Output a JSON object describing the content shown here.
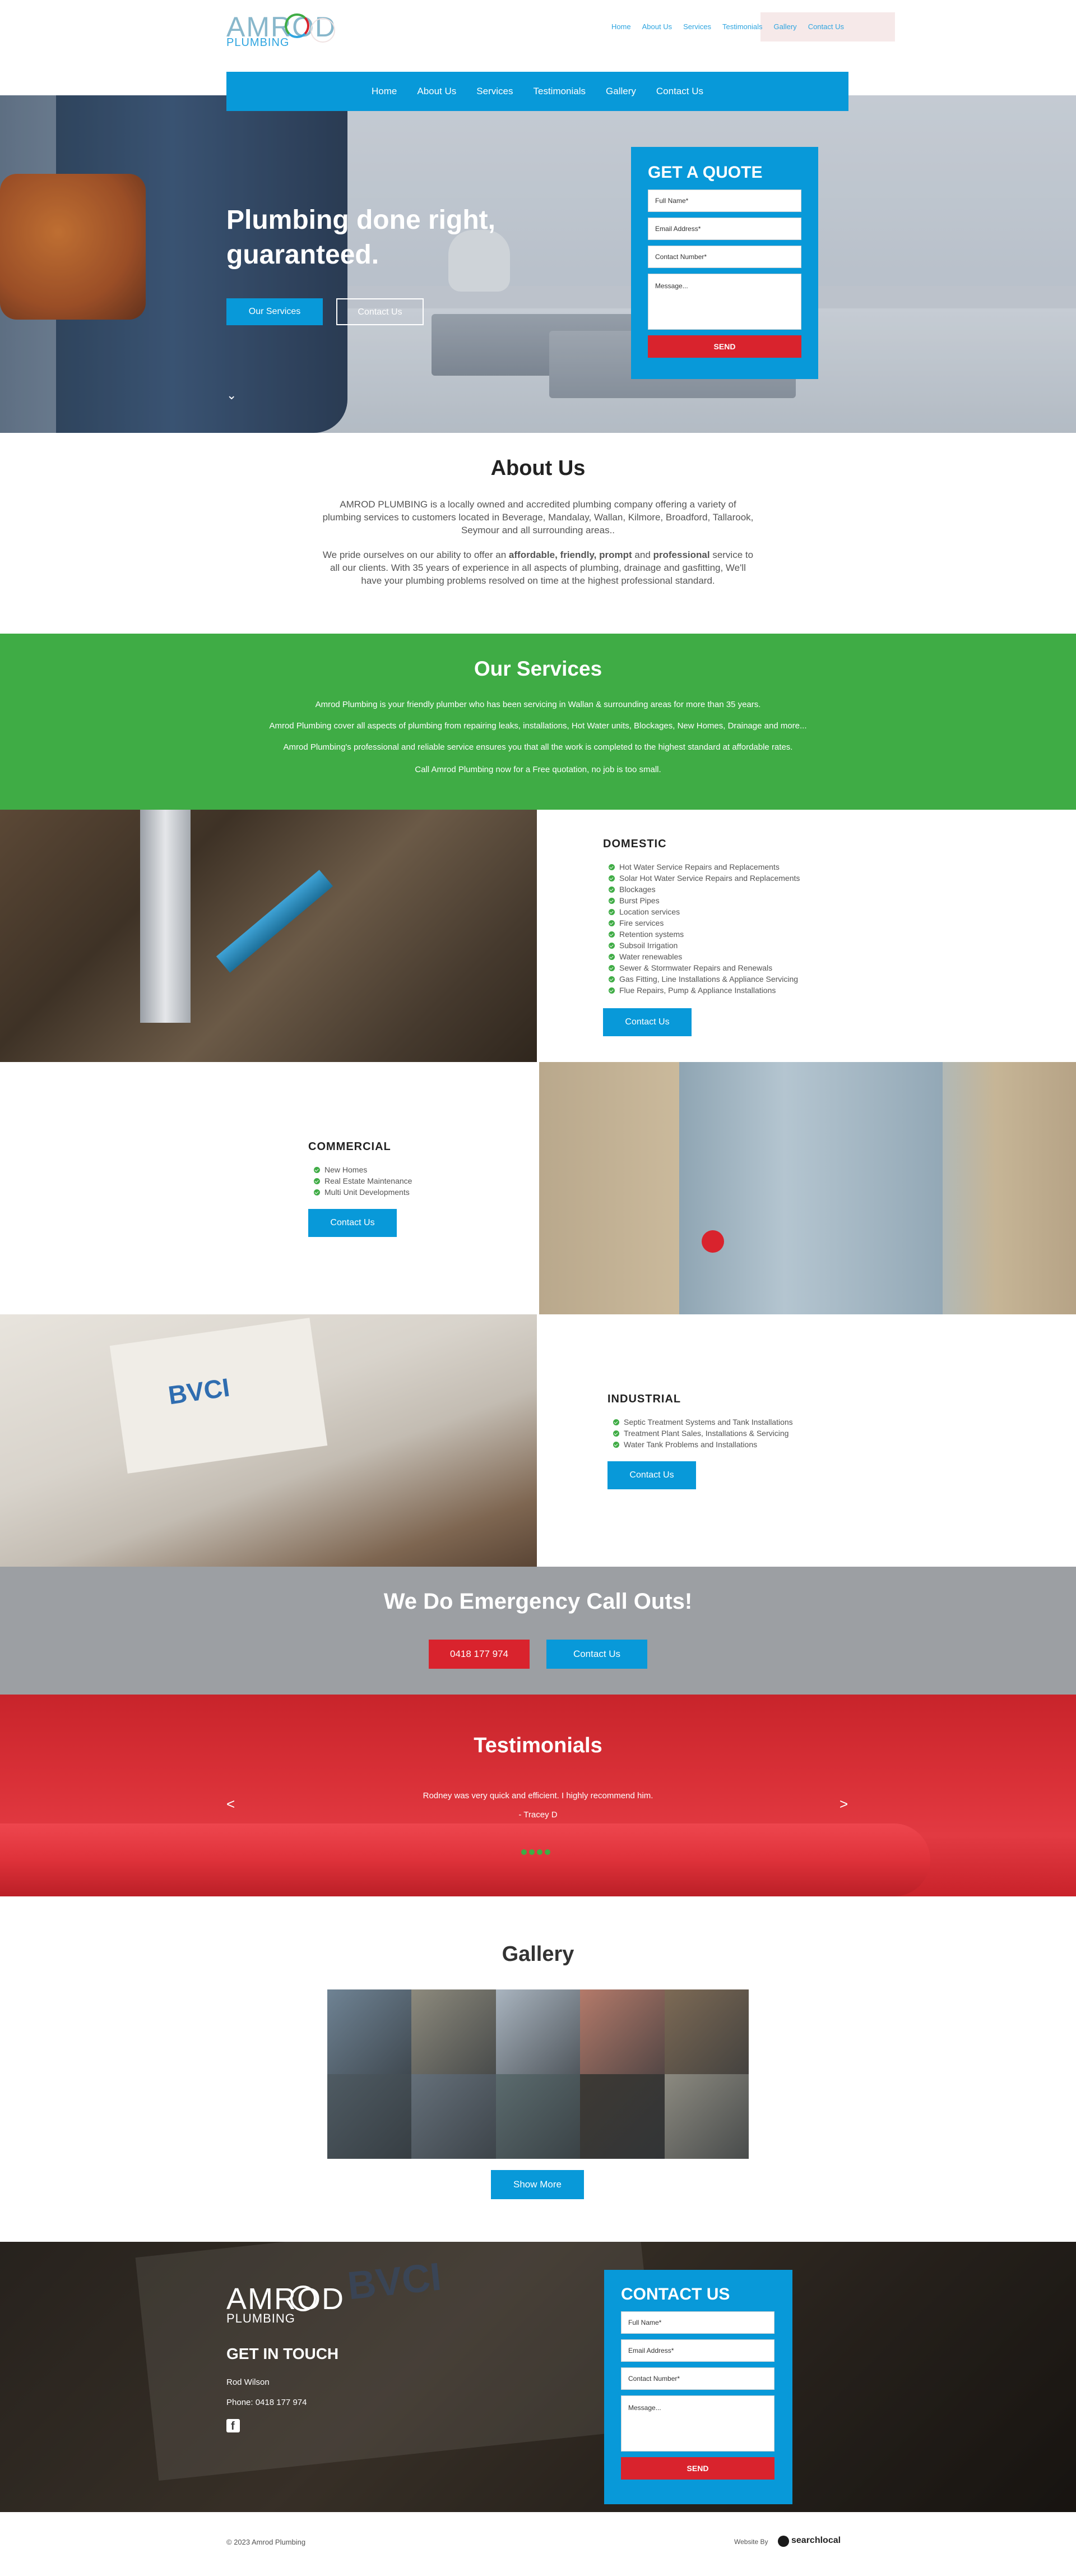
{
  "brand": {
    "name": "AMROD",
    "tagline": "PLUMBING",
    "color_blue": "#0899d9",
    "color_green": "#3fac45",
    "color_red": "#d9232d"
  },
  "top_links": [
    "Home",
    "About Us",
    "Services",
    "Testimonials",
    "Gallery",
    "Contact Us"
  ],
  "nav": [
    "Home",
    "About Us",
    "Services",
    "Testimonials",
    "Gallery",
    "Contact Us"
  ],
  "hero": {
    "title_line1": "Plumbing done right,",
    "title_line2": "guaranteed.",
    "btn_services": "Our Services",
    "btn_contact": "Contact Us",
    "scroll_icon": "chevron-down-icon"
  },
  "quote_form": {
    "title": "GET A QUOTE",
    "full_name": "Full Name*",
    "email": "Email Address*",
    "phone": "Contact Number*",
    "message": "Message...",
    "send": "SEND"
  },
  "about": {
    "title": "About Us",
    "p1": "AMROD PLUMBING is a locally owned and accredited plumbing company offering a variety of plumbing services to customers located in Beverage, Mandalay, Wallan, Kilmore, Broadford, Tallarook, Seymour and all surrounding areas..",
    "p2_a": "We pride ourselves on our ability to offer an ",
    "p2_b": "affordable, friendly, prompt",
    "p2_c": " and ",
    "p2_d": "professional",
    "p2_e": " service to all our clients. With 35 years of experience in all aspects of plumbing, drainage and gasfitting, We'll have your plumbing problems resolved on time at the highest professional standard."
  },
  "services": {
    "title": "Our Services",
    "lines": [
      "Amrod Plumbing is your friendly plumber who has been servicing in Wallan & surrounding areas for more than 35 years.",
      "Amrod Plumbing cover all aspects of plumbing from repairing leaks, installations, Hot Water units, Blockages, New Homes, Drainage and more...",
      "Amrod Plumbing's professional and reliable service ensures you that all the work is completed to the highest standard at affordable rates.",
      "Call Amrod Plumbing now for a Free quotation, no job is too small."
    ],
    "domestic": {
      "title": "DOMESTIC",
      "items": [
        "Hot Water Service Repairs and Replacements",
        "Solar Hot Water Service Repairs and Replacements",
        "Blockages",
        "Burst Pipes",
        "Location services",
        "Fire services",
        "Retention systems",
        "Subsoil Irrigation",
        "Water renewables",
        "Sewer & Stormwater Repairs and Renewals",
        "Gas Fitting, Line Installations & Appliance Servicing",
        "Flue Repairs, Pump & Appliance Installations"
      ],
      "button": "Contact Us"
    },
    "commercial": {
      "title": "COMMERCIAL",
      "items": [
        "New Homes",
        "Real Estate Maintenance",
        "Multi Unit Developments"
      ],
      "button": "Contact Us"
    },
    "industrial": {
      "title": "INDUSTRIAL",
      "items": [
        "Septic Treatment Systems and Tank Installations",
        "Treatment Plant Sales, Installations & Servicing",
        "Water Tank Problems and Installations"
      ],
      "button": "Contact Us"
    }
  },
  "emergency": {
    "title": "We Do Emergency Call Outs!",
    "phone": "0418 177 974",
    "contact": "Contact Us"
  },
  "testimonials": {
    "title": "Testimonials",
    "quote": "Rodney was very quick and efficient. I highly recommend him.",
    "author": "- Tracey D",
    "prev": "<",
    "next": ">"
  },
  "gallery": {
    "title": "Gallery",
    "button": "Show More",
    "tile_colors": [
      "#6f8394",
      "#8d8a7d",
      "#a9b4bf",
      "#b47a6a",
      "#7d6a55",
      "#4f5b63",
      "#65707a",
      "#5b6b6e",
      "#3e3a35",
      "#8c8a80"
    ]
  },
  "footer": {
    "get_in_touch": "GET IN TOUCH",
    "name": "Rod Wilson",
    "phone": "Phone: 0418 177 974",
    "facebook_icon": "facebook-icon",
    "contact_title": "CONTACT US",
    "full_name": "Full Name*",
    "email": "Email Address*",
    "phone_field": "Contact Number*",
    "message": "Message...",
    "send": "SEND",
    "copyright": "© 2023 Amrod Plumbing",
    "website_by": "Website By",
    "agency": "searchlocal"
  }
}
